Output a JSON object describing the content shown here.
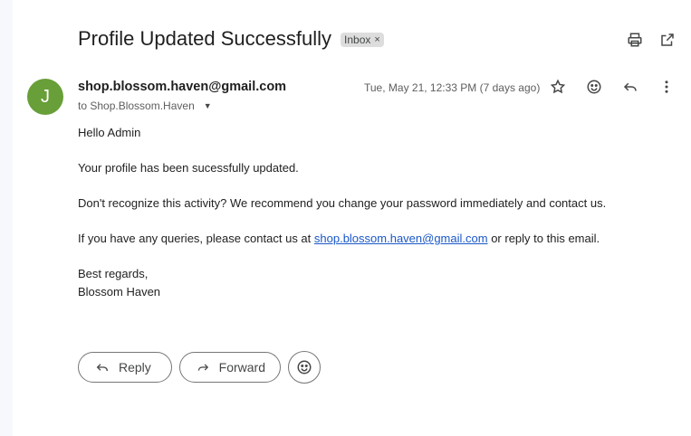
{
  "email": {
    "subject": "Profile Updated Successfully",
    "label": "Inbox",
    "label_remove": "×",
    "sender_email": "shop.blossom.haven@gmail.com",
    "avatar_letter": "J",
    "avatar_color": "#689f38",
    "to_line": "to Shop.Blossom.Haven",
    "date": "Tue, May 21, 12:33 PM (7 days ago)",
    "greeting": "Hello Admin",
    "line1": "Your profile has been sucessfully updated.",
    "line2": "Don't recognize this activity? We recommend you change your password immediately and contact us.",
    "line3_prefix": "If you have any queries, please contact us at ",
    "line3_link": "shop.blossom.haven@gmail.com",
    "line3_suffix": " or reply to this email.",
    "signoff": "Best regards,",
    "signature": "Blossom Haven"
  },
  "actions": {
    "reply_label": "Reply",
    "forward_label": "Forward"
  },
  "icons": {
    "top": [
      "print-icon",
      "open-in-new-window-icon"
    ],
    "header": [
      "star-icon",
      "emoji-reaction-icon",
      "reply-icon",
      "more-vert-icon"
    ]
  }
}
